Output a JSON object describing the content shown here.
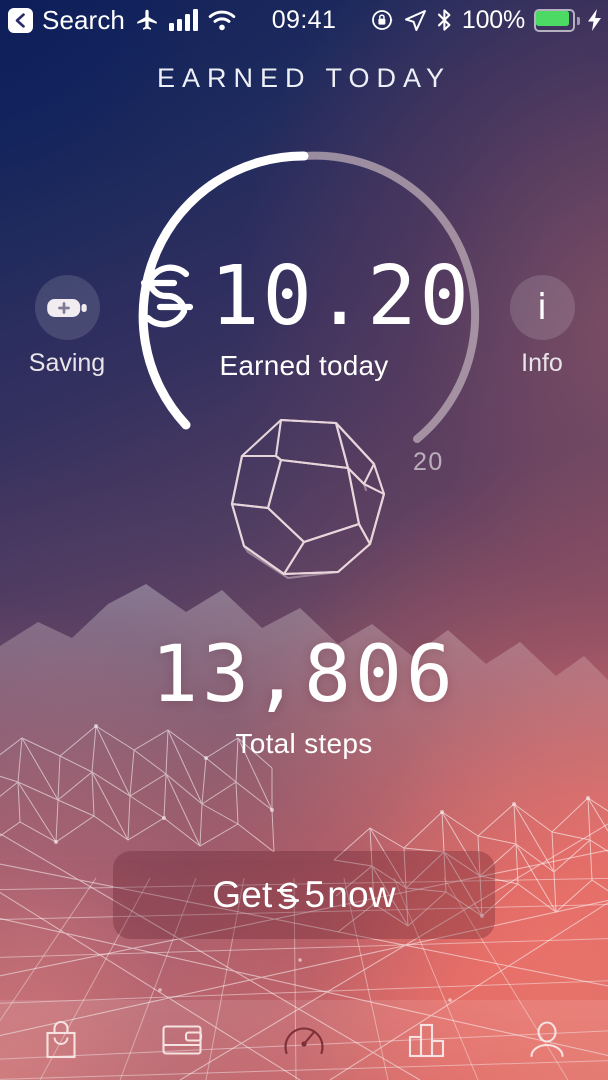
{
  "status_bar": {
    "back_label": "Search",
    "back_icon": "chevron-left-icon",
    "airplane_icon": "airplane-mode-icon",
    "signal_icon": "cellular-signal-icon",
    "wifi_icon": "wifi-icon",
    "time": "09:41",
    "rotation_lock_icon": "rotation-lock-icon",
    "location_icon": "location-arrow-icon",
    "bluetooth_icon": "bluetooth-icon",
    "battery_percent": "100%",
    "battery_icon": "battery-full-icon",
    "charging_icon": "charging-bolt-icon",
    "battery_color": "#4cd964"
  },
  "header": {
    "title": "EARNED TODAY"
  },
  "earned": {
    "currency_icon": "sweatcoin-symbol-icon",
    "value": "10.20",
    "caption": "Earned today",
    "ring_max_label": "20",
    "ring_progress_color": "#ffffff",
    "ring_track_color": "#b9a8b4"
  },
  "saving_button": {
    "label": "Saving",
    "icon": "battery-boost-icon"
  },
  "info_button": {
    "label": "Info",
    "icon": "info-icon",
    "glyph": "i"
  },
  "polyhedron": {
    "icon": "dodecahedron-wireframe-icon"
  },
  "steps": {
    "value": "13,806",
    "caption": "Total steps"
  },
  "cta": {
    "prefix": "Get ",
    "currency_icon": "sweatcoin-symbol-icon",
    "amount": "5",
    "suffix": " now"
  },
  "tabbar": {
    "items": [
      {
        "name": "shop",
        "icon": "shopping-bag-icon",
        "active": false
      },
      {
        "name": "wallet",
        "icon": "wallet-icon",
        "active": false
      },
      {
        "name": "dashboard",
        "icon": "speedometer-icon",
        "active": true
      },
      {
        "name": "stats",
        "icon": "bar-chart-icon",
        "active": false
      },
      {
        "name": "profile",
        "icon": "person-icon",
        "active": false
      }
    ]
  },
  "chart_data": {
    "type": "gauge",
    "title": "Earned today",
    "value": 10.2,
    "min": 0,
    "max": 20,
    "unit": "sweatcoin",
    "max_tick_label": "20",
    "progress_fraction": 0.51,
    "secondary_metric": {
      "label": "Total steps",
      "value": 13806
    }
  }
}
